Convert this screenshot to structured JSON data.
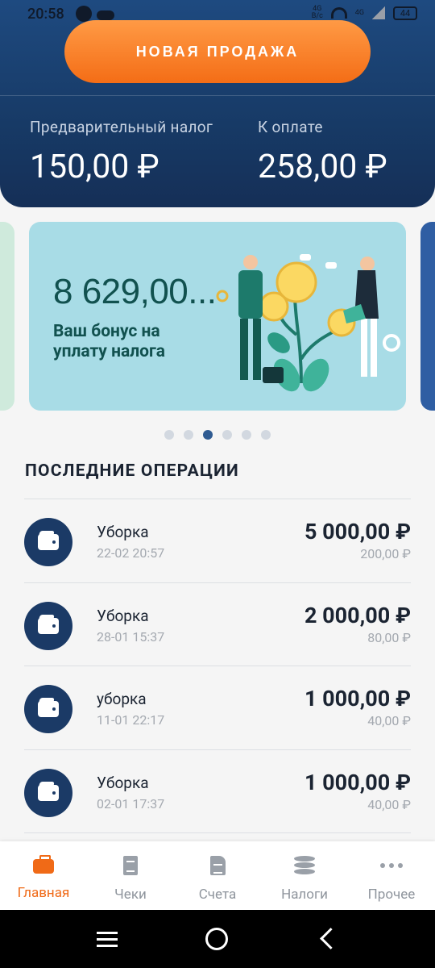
{
  "status_bar": {
    "time": "20:58",
    "network": "4G",
    "network_sub": "B/c",
    "network_small": "4G",
    "battery": "44"
  },
  "header": {
    "new_sale_label": "НОВАЯ ПРОДАЖА",
    "prelim_tax_label": "Предварительный налог",
    "prelim_tax_value": "150,00 ₽",
    "to_pay_label": "К оплате",
    "to_pay_value": "258,00 ₽"
  },
  "carousel": {
    "bonus_amount": "8 629,00...",
    "bonus_text": "Ваш бонус на уплату налога",
    "dots_count": 6,
    "active_dot": 2
  },
  "operations": {
    "title": "ПОСЛЕДНИЕ ОПЕРАЦИИ",
    "items": [
      {
        "title": "Уборка",
        "date": "22-02 20:57",
        "amount": "5 000,00 ₽",
        "tax": "200,00 ₽"
      },
      {
        "title": "Уборка",
        "date": "28-01 15:37",
        "amount": "2 000,00 ₽",
        "tax": "80,00 ₽"
      },
      {
        "title": "уборка",
        "date": "11-01 22:17",
        "amount": "1 000,00 ₽",
        "tax": "40,00 ₽"
      },
      {
        "title": "Уборка",
        "date": "02-01 17:37",
        "amount": "1 000,00 ₽",
        "tax": "40,00 ₽"
      }
    ]
  },
  "bottom_nav": {
    "items": [
      {
        "label": "Главная",
        "icon": "briefcase-icon",
        "active": true
      },
      {
        "label": "Чеки",
        "icon": "receipt-icon",
        "active": false
      },
      {
        "label": "Счета",
        "icon": "document-icon",
        "active": false
      },
      {
        "label": "Налоги",
        "icon": "coins-icon",
        "active": false
      },
      {
        "label": "Прочее",
        "icon": "more-icon",
        "active": false
      }
    ]
  },
  "colors": {
    "accent": "#f06a17",
    "header": "#1e4a80",
    "text": "#1b2432"
  }
}
